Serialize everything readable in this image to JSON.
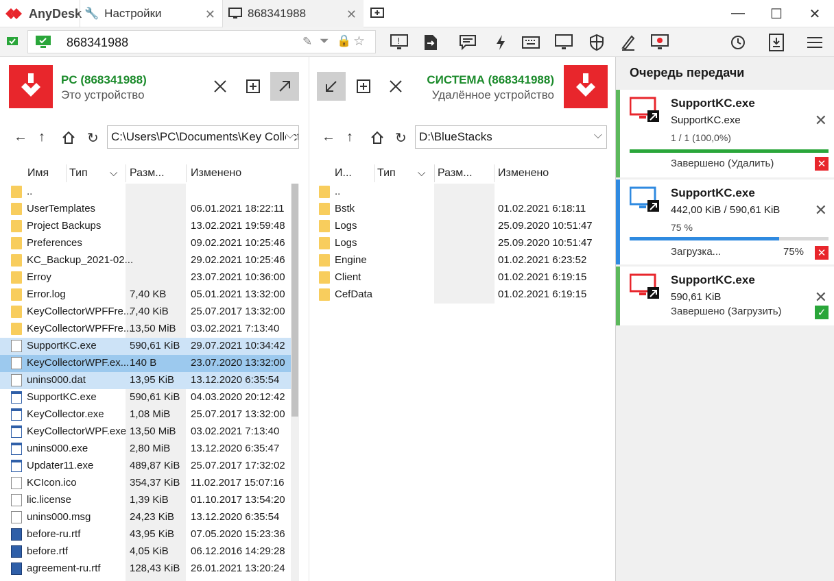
{
  "app": {
    "name": "AnyDesk"
  },
  "tabs": [
    {
      "label": "Настройки",
      "icon": "wrench-icon"
    },
    {
      "label": "868341988",
      "icon": "monitor-icon"
    }
  ],
  "toolbar": {
    "address": "868341988"
  },
  "local": {
    "title": "PC (868341988)",
    "subtitle": "Это устройство",
    "path": "C:\\Users\\PC\\Documents\\Key Collector",
    "columns": {
      "name": "Имя",
      "type": "Тип",
      "size": "Разм...",
      "modified": "Изменено"
    },
    "files": [
      {
        "name": "..",
        "size": "",
        "modified": "",
        "kind": "folder",
        "sel": ""
      },
      {
        "name": "UserTemplates",
        "size": "",
        "modified": "06.01.2021 18:22:11",
        "kind": "folder",
        "sel": ""
      },
      {
        "name": "Project Backups",
        "size": "",
        "modified": "13.02.2021 19:59:48",
        "kind": "folder",
        "sel": ""
      },
      {
        "name": "Preferences",
        "size": "",
        "modified": "09.02.2021 10:25:46",
        "kind": "folder",
        "sel": ""
      },
      {
        "name": "KC_Backup_2021-02...",
        "size": "",
        "modified": "29.02.2021 10:25:46",
        "kind": "folder",
        "sel": ""
      },
      {
        "name": "Erroy",
        "size": "",
        "modified": "23.07.2021 10:36:00",
        "kind": "folder",
        "sel": ""
      },
      {
        "name": "Error.log",
        "size": "7,40 KB",
        "modified": "05.01.2021 13:32:00",
        "kind": "folder",
        "sel": ""
      },
      {
        "name": "KeyCollectorWPFFre...",
        "size": "7,40 KiB",
        "modified": "25.07.2017 13:32:00",
        "kind": "folder",
        "sel": ""
      },
      {
        "name": "KeyCollectorWPFFre...",
        "size": "13,50 MiB",
        "modified": "03.02.2021 7:13:40",
        "kind": "folder",
        "sel": ""
      },
      {
        "name": "SupportKC.exe",
        "size": "590,61 KiB",
        "modified": "29.07.2021 10:34:42",
        "kind": "file",
        "sel": "light"
      },
      {
        "name": "KeyCollectorWPF.ex...",
        "size": "140 B",
        "modified": "23.07.2020 13:32:00",
        "kind": "file",
        "sel": "dark"
      },
      {
        "name": "unins000.dat",
        "size": "13,95 KiB",
        "modified": "13.12.2020 6:35:54",
        "kind": "file",
        "sel": "light"
      },
      {
        "name": "SupportKC.exe",
        "size": "590,61 KiB",
        "modified": "04.03.2020 20:12:42",
        "kind": "exe",
        "sel": ""
      },
      {
        "name": "KeyCollector.exe",
        "size": "1,08 MiB",
        "modified": "25.07.2017 13:32:00",
        "kind": "exe",
        "sel": ""
      },
      {
        "name": "KeyCollectorWPF.exe",
        "size": "13,50 MiB",
        "modified": "03.02.2021 7:13:40",
        "kind": "exe",
        "sel": ""
      },
      {
        "name": "unins000.exe",
        "size": "2,80 MiB",
        "modified": "13.12.2020 6:35:47",
        "kind": "exe",
        "sel": ""
      },
      {
        "name": "Updater11.exe",
        "size": "489,87 KiB",
        "modified": "25.07.2017 17:32:02",
        "kind": "exe",
        "sel": ""
      },
      {
        "name": "KCIcon.ico",
        "size": "354,37 KiB",
        "modified": "11.02.2017 15:07:16",
        "kind": "file",
        "sel": ""
      },
      {
        "name": "lic.license",
        "size": "1,39 KiB",
        "modified": "01.10.2017 13:54:20",
        "kind": "file",
        "sel": ""
      },
      {
        "name": "unins000.msg",
        "size": "24,23 KiB",
        "modified": "13.12.2020 6:35:54",
        "kind": "file",
        "sel": ""
      },
      {
        "name": "before-ru.rtf",
        "size": "43,95 KiB",
        "modified": "07.05.2020 15:23:36",
        "kind": "doc",
        "sel": ""
      },
      {
        "name": "before.rtf",
        "size": "4,05 KiB",
        "modified": "06.12.2016 14:29:28",
        "kind": "doc",
        "sel": ""
      },
      {
        "name": "agreement-ru.rtf",
        "size": "128,43 KiB",
        "modified": "26.01.2021 13:20:24",
        "kind": "doc",
        "sel": ""
      }
    ]
  },
  "remote": {
    "title": "СИСТЕМА (868341988)",
    "subtitle": "Удалённое устройство",
    "path": "D:\\BlueStacks",
    "columns": {
      "name": "И...",
      "type": "Тип",
      "size": "Разм...",
      "modified": "Изменено"
    },
    "files": [
      {
        "name": "..",
        "modified": ""
      },
      {
        "name": "Bstk",
        "modified": "01.02.2021 6:18:11"
      },
      {
        "name": "Logs",
        "modified": "25.09.2020 10:51:47"
      },
      {
        "name": "Logs",
        "modified": "25.09.2020 10:51:47"
      },
      {
        "name": "Engine",
        "modified": "01.02.2021 6:23:52"
      },
      {
        "name": "Client",
        "modified": "01.02.2021 6:19:15"
      },
      {
        "name": "CefData",
        "modified": "01.02.2021 6:19:15"
      }
    ]
  },
  "queue": {
    "title": "Очередь передачи",
    "items": [
      {
        "name": "SupportKC.exe",
        "line2": "SupportKC.exe",
        "line3": "1 / 1 (100,0%)",
        "status": "Завершено (Удалить)",
        "percent": "",
        "progress": 1.0,
        "color": "#e8262c",
        "stripe": "#5cb85c",
        "bar_color": "#2aa63a",
        "action": "delete"
      },
      {
        "name": "SupportKC.exe",
        "line2": "442,00 KiB / 590,61 KiB",
        "line3": "75 %",
        "status": "Загрузка...",
        "percent": "75%",
        "progress": 0.75,
        "color": "#2f8ae0",
        "stripe": "#2f8ae0",
        "bar_color": "#2f8ae0",
        "action": "delete"
      },
      {
        "name": "SupportKC.exe",
        "line2": "590,61 KiB",
        "line3": "",
        "status": "Завершено (Загрузить)",
        "percent": "",
        "progress": null,
        "color": "#e8262c",
        "stripe": "#5cb85c",
        "bar_color": "",
        "action": "ok"
      }
    ]
  }
}
